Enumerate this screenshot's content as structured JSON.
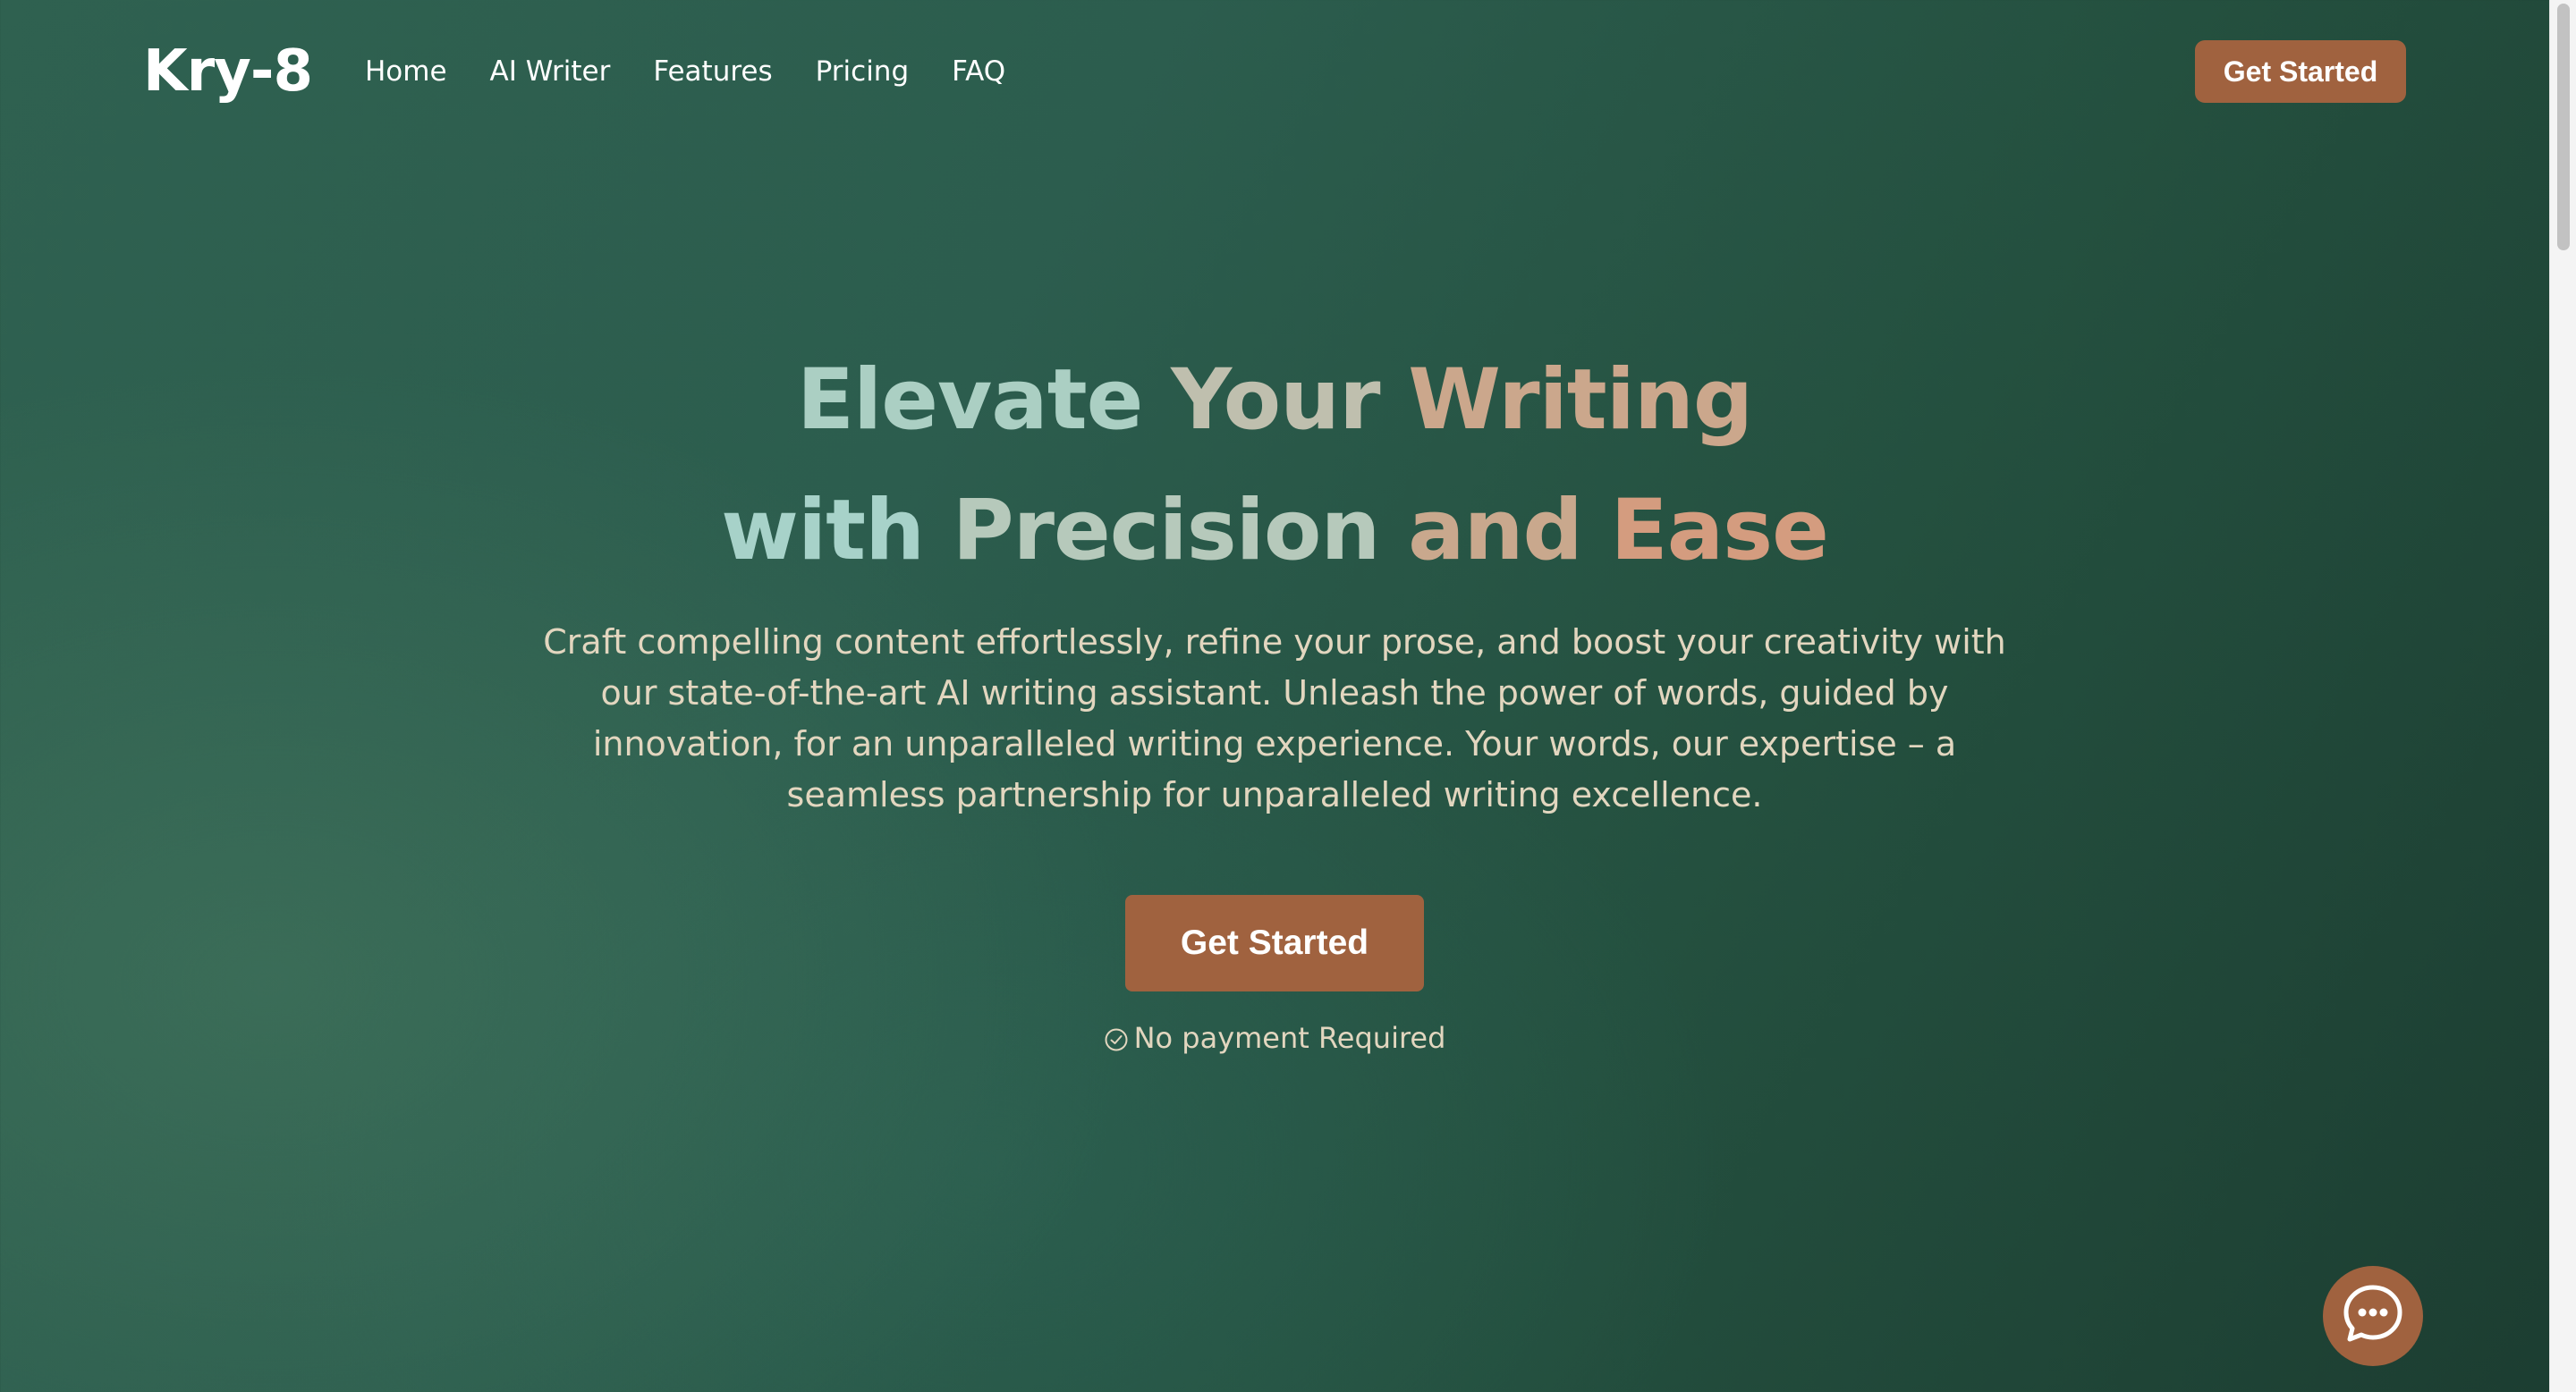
{
  "nav": {
    "logo": "Kry-8",
    "links": [
      "Home",
      "AI Writer",
      "Features",
      "Pricing",
      "FAQ"
    ],
    "cta_label": "Get Started"
  },
  "hero": {
    "title_line1": [
      "Elevate",
      "Your",
      "Writing"
    ],
    "title_line2": [
      "with",
      "Precision",
      "and",
      "Ease"
    ],
    "subtitle": "Craft compelling content effortlessly, refine your prose, and boost your creativity with our state-of-the-art AI writing assistant. Unleash the power of words, guided by innovation, for an unparalleled writing experience. Your words, our expertise – a seamless partnership for unparalleled writing excellence.",
    "cta_label": "Get Started",
    "note": "No payment Required"
  },
  "icons": {
    "note_icon": "check-circle-icon",
    "chat_icon": "chat-bubble-icon"
  },
  "colors": {
    "accent": "#a0623f",
    "title_teal": "#a9cfc4",
    "title_tan": "#c9a98c",
    "title_copper": "#d19a7d",
    "body_text": "#e2d6bf"
  }
}
